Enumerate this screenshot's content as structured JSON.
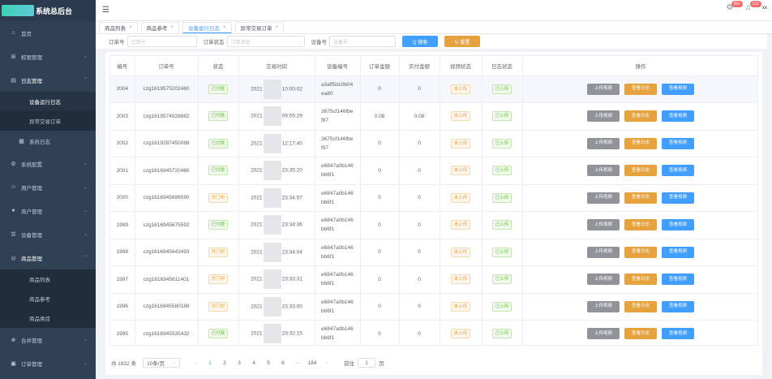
{
  "brand": {
    "title": "系统总后台"
  },
  "sidebar": {
    "items": [
      {
        "label": "首页",
        "icon": "home-icon",
        "glyph": "⌂"
      },
      {
        "label": "权限管理",
        "icon": "lock-icon",
        "glyph": "⊞",
        "arrow": "⌄"
      },
      {
        "label": "日志管理",
        "icon": "log-icon",
        "glyph": "▤",
        "arrow": "⌃"
      }
    ],
    "log_sub": [
      {
        "label": "设备运行日志"
      },
      {
        "label": "异常交易订单"
      }
    ],
    "system_log": {
      "label": "系统日志",
      "glyph": "▦"
    },
    "items_after": [
      {
        "label": "系统配置",
        "icon": "settings-icon",
        "glyph": "⚙",
        "arrow": "⌄"
      },
      {
        "label": "用户管理",
        "icon": "users-icon",
        "glyph": "☺",
        "arrow": "⌄"
      },
      {
        "label": "商户管理",
        "icon": "merchant-icon",
        "glyph": "●",
        "arrow": "⌄"
      },
      {
        "label": "设备管理",
        "icon": "device-icon",
        "glyph": "☰",
        "arrow": "⌄"
      },
      {
        "label": "商品管理",
        "icon": "goods-icon",
        "glyph": "◎",
        "arrow": "⌃"
      }
    ],
    "goods_sub": [
      {
        "label": "商品列表"
      },
      {
        "label": "商品参考"
      },
      {
        "label": "商品类目"
      }
    ],
    "items_end": [
      {
        "label": "合并管理",
        "icon": "merge-icon",
        "glyph": "⊕",
        "arrow": "⌄"
      },
      {
        "label": "订单管理",
        "icon": "order-icon",
        "glyph": "▣",
        "arrow": "⌄"
      }
    ]
  },
  "topbar": {
    "hamburger": "☰",
    "settings_glyph": "⚙",
    "bell_glyph": "♫",
    "settings_badge": "99+",
    "bell_badge": "122",
    "user": "xx"
  },
  "tabs": [
    {
      "label": "商品列表",
      "close": "×"
    },
    {
      "label": "商品参考",
      "close": "×"
    },
    {
      "label": "设备运行日志",
      "close": "×"
    },
    {
      "label": "异常交易订单",
      "close": "×"
    }
  ],
  "filters": {
    "order_label": "订单号",
    "order_placeholder": "订单号",
    "status_label": "订单状态",
    "status_placeholder": "订单状态",
    "device_label": "设备号",
    "device_placeholder": "设备号",
    "search": "Q 搜索",
    "reset": "↻ 重置",
    "caret": "⌄"
  },
  "table": {
    "headers": [
      "编号",
      "订单号",
      "状态",
      "交易时间",
      "设备编号",
      "订单金额",
      "实付金额",
      "视频状态",
      "日志状态",
      "操作"
    ],
    "ops": {
      "upload": "上传视频",
      "log": "查看日志",
      "video": "查看视频"
    },
    "rows": [
      {
        "id": "2004",
        "order": "czg1619575202460",
        "status": "已付款",
        "status_color": "green",
        "time_a": "2021",
        "time_b": "10:00:02",
        "device": "a3aff5dc0b04ea80",
        "amount": "0",
        "paid": "0",
        "video": "未上传",
        "log": "已上传"
      },
      {
        "id": "2003",
        "order": "czg1619574928882",
        "status": "已付款",
        "status_color": "green",
        "time_a": "2021",
        "time_b": "09:55:29",
        "device": "3675cf146fbef97",
        "amount": "0.08",
        "paid": "0.08",
        "video": "未上传",
        "log": "已上传"
      },
      {
        "id": "2002",
        "order": "czg1619287450088",
        "status": "已付款",
        "status_color": "green",
        "time_a": "2021",
        "time_b": "12:17:40",
        "device": "3675cf146fbef97",
        "amount": "0",
        "paid": "0",
        "video": "未上传",
        "log": "已上传"
      },
      {
        "id": "2001",
        "order": "czg1616945720460",
        "status": "已付款",
        "status_color": "green",
        "time_a": "2021",
        "time_b": "23:35:20",
        "device": "e6847a0b146bb6f1",
        "amount": "0",
        "paid": "0",
        "video": "未上传",
        "log": "已上传"
      },
      {
        "id": "2000",
        "order": "czg1616945696590",
        "status": "开门中",
        "status_color": "orange",
        "time_a": "2021",
        "time_b": "23:34:57",
        "device": "e6847a0b146bb6f1",
        "amount": "0",
        "paid": "0",
        "video": "未上传",
        "log": "已上传"
      },
      {
        "id": "1999",
        "order": "czg1616945675592",
        "status": "已付款",
        "status_color": "green",
        "time_a": "2021",
        "time_b": "23:34:36",
        "device": "e6847a0b146bb6f1",
        "amount": "0",
        "paid": "0",
        "video": "未上传",
        "log": "已上传"
      },
      {
        "id": "1998",
        "order": "czg1616945643493",
        "status": "开门中",
        "status_color": "orange",
        "time_a": "2021",
        "time_b": "23:34:04",
        "device": "e6847a0b146bb6f1",
        "amount": "0",
        "paid": "0",
        "video": "未上传",
        "log": "已上传"
      },
      {
        "id": "1997",
        "order": "czg1616945611401",
        "status": "开门中",
        "status_color": "orange",
        "time_a": "2021",
        "time_b": "23:33:31",
        "device": "e6847a0b146bb6f1",
        "amount": "0",
        "paid": "0",
        "video": "未上传",
        "log": "已上传"
      },
      {
        "id": "1996",
        "order": "czg1616945580188",
        "status": "开门中",
        "status_color": "orange",
        "time_a": "2021",
        "time_b": "23:33:00",
        "device": "e6847a0b146bb6f1",
        "amount": "0",
        "paid": "0",
        "video": "未上传",
        "log": "已上传"
      },
      {
        "id": "1995",
        "order": "czg1616945535432",
        "status": "已付款",
        "status_color": "green",
        "time_a": "2021",
        "time_b": "23:32:15",
        "device": "e6847a0b146bb6f1",
        "amount": "0",
        "paid": "0",
        "video": "未上传",
        "log": "已上传"
      }
    ]
  },
  "pagination": {
    "total": "共 1832 条",
    "page_size": "10条/页",
    "prev": "‹",
    "pages": [
      "1",
      "2",
      "3",
      "4",
      "5",
      "6",
      "···",
      "184"
    ],
    "next": "›",
    "goto_label": "前往",
    "goto_value": "1",
    "goto_suffix": "页"
  },
  "colors": {
    "sidebar": "#304156",
    "primary": "#409eff",
    "warning": "#e6a23c",
    "success": "#67c23a",
    "info": "#909399"
  }
}
